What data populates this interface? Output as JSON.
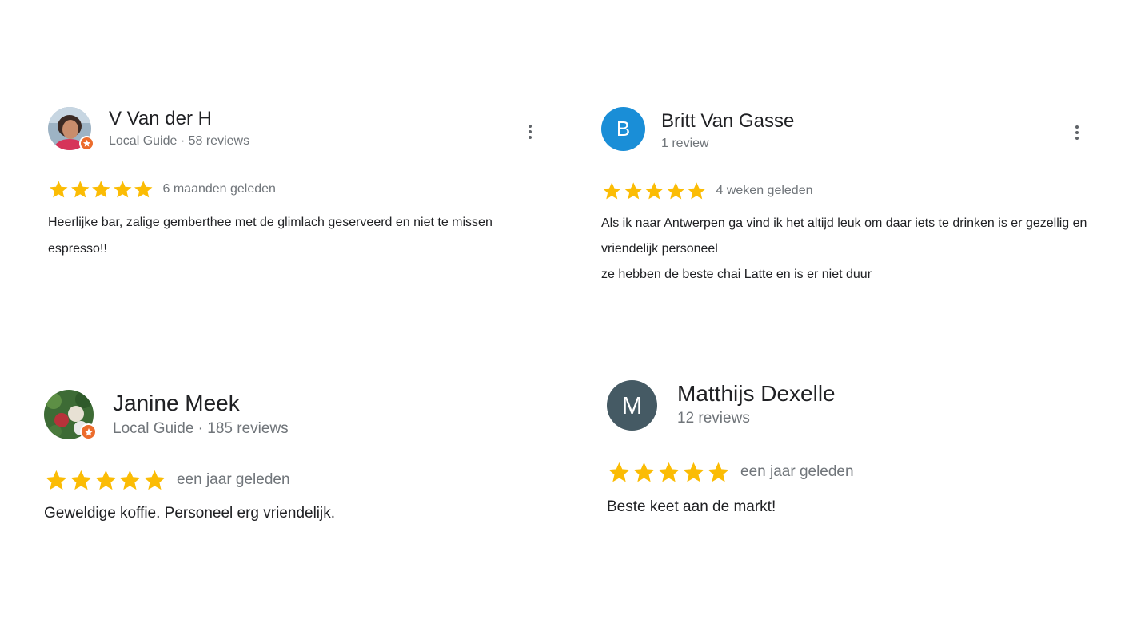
{
  "theme": {
    "star_color": "#fbbc04",
    "meta_color": "#70757a",
    "text_color": "#202124",
    "local_guide_badge_color": "#ec6c2c"
  },
  "reviews": [
    {
      "reviewer_name": "V Van der H",
      "reviewer_meta": "Local Guide · 58 reviews",
      "avatar": {
        "type": "photo",
        "icon": "profile-photo"
      },
      "local_guide": true,
      "rating": 5,
      "date": "6 maanden geleden",
      "text": "Heerlijke bar, zalige gemberthee met de glimlach geserveerd en niet te missen espresso!!",
      "has_more_menu": true
    },
    {
      "reviewer_name": "Britt Van Gasse",
      "reviewer_meta": "1 review",
      "avatar": {
        "type": "letter",
        "letter": "B",
        "color": "#1a8ed7"
      },
      "local_guide": false,
      "rating": 5,
      "date": "4 weken geleden",
      "text": "Als ik naar Antwerpen ga vind ik het altijd  leuk om daar iets te drinken is er gezellig en vriendelijk personeel\nze hebben de beste chai Latte en is er niet duur",
      "has_more_menu": true
    },
    {
      "reviewer_name": "Janine Meek",
      "reviewer_meta": "Local Guide · 185 reviews",
      "avatar": {
        "type": "photo",
        "icon": "profile-photo"
      },
      "local_guide": true,
      "rating": 5,
      "date": "een jaar geleden",
      "text": "Geweldige koffie. Personeel erg vriendelijk.",
      "has_more_menu": false
    },
    {
      "reviewer_name": "Matthijs Dexelle",
      "reviewer_meta": "12 reviews",
      "avatar": {
        "type": "letter",
        "letter": "M",
        "color": "#455a64"
      },
      "local_guide": false,
      "rating": 5,
      "date": "een jaar geleden",
      "text": "Beste keet aan de markt!",
      "has_more_menu": false
    }
  ]
}
